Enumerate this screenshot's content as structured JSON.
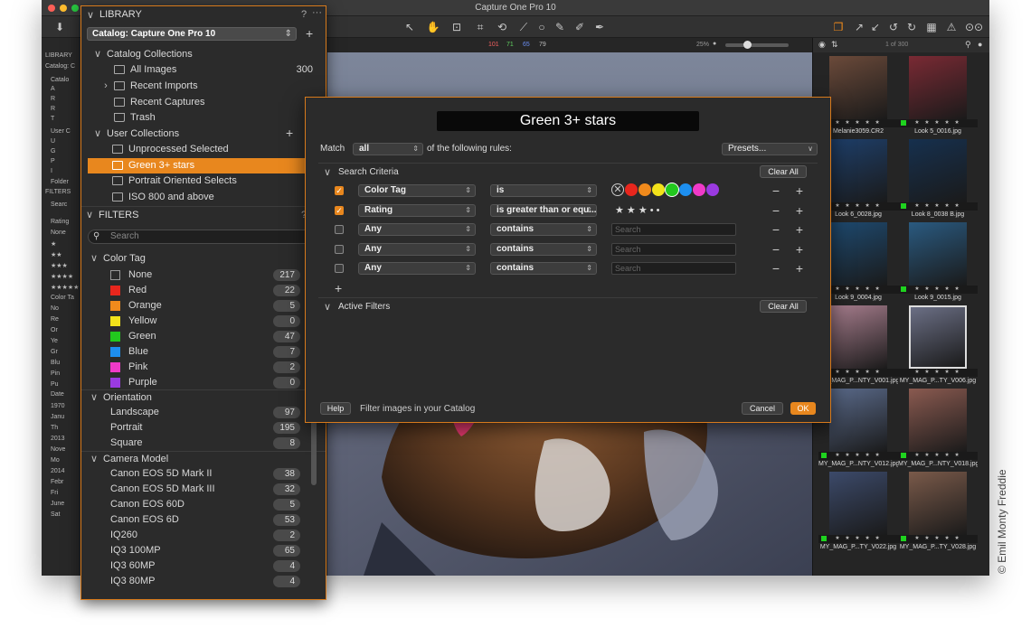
{
  "app": {
    "title": "Capture One Pro 10"
  },
  "viewer": {
    "counts": [
      "101",
      "71",
      "65",
      "79"
    ],
    "zoom": "25%"
  },
  "browser": {
    "counter": "1 of 300",
    "thumbs": [
      {
        "name": "Melanie3059.CR2",
        "stars": "★ ★ ★ ★ ★",
        "green": false
      },
      {
        "name": "Look 5_0016.jpg",
        "stars": "★ ★ ★ ★ ★",
        "green": true
      },
      {
        "name": "Look 6_0028.jpg",
        "stars": "★ ★ ★ ★ ★",
        "green": true
      },
      {
        "name": "Look 8_0038 B.jpg",
        "stars": "★ ★ ★ ★ ★",
        "green": true
      },
      {
        "name": "Look 9_0004.jpg",
        "stars": "★ ★ ★ ★ ★",
        "green": false
      },
      {
        "name": "Look 9_0015.jpg",
        "stars": "★ ★ ★ ★ ★",
        "green": true
      },
      {
        "name": "MY_MAG_P...NTY_V001.jpg",
        "stars": "★ ★ ★ ★ ★",
        "green": false
      },
      {
        "name": "MY_MAG_P...TY_V006.jpg",
        "stars": "★ ★ ★ ★ ★",
        "green": false
      },
      {
        "name": "MY_MAG_P...NTY_V012.jpg",
        "stars": "★ ★ ★ ★ ★",
        "green": true
      },
      {
        "name": "MY_MAG_P...NTY_V018.jpg",
        "stars": "★ ★ ★ ★ ★",
        "green": true
      },
      {
        "name": "MY_MAG_P...TY_V022.jpg",
        "stars": "★ ★ ★ ★ ★",
        "green": true
      },
      {
        "name": "MY_MAG_P...TY_V028.jpg",
        "stars": "★ ★ ★ ★ ★",
        "green": true
      }
    ]
  },
  "leftmini": {
    "rows": [
      "LIBRARY",
      "Catalog: C",
      "Catalo",
      "A",
      "R",
      "R",
      "T",
      "User C",
      "U",
      "G",
      "P",
      "I",
      "Folder",
      "FILTERS",
      "Searc",
      "Rating",
      "None",
      "★",
      "★★",
      "★★★",
      "★★★★",
      "★★★★★",
      "Color Ta",
      "No",
      "Re",
      "Or",
      "Ye",
      "Gr",
      "Blu",
      "Pin",
      "Pu",
      "Date",
      "1970",
      "Janu",
      "Th",
      "2013",
      "Nove",
      "Mo",
      "2014",
      "Febr",
      "Fri",
      "June",
      "Sat"
    ]
  },
  "library": {
    "title": "LIBRARY",
    "help": "?",
    "more": "···",
    "catalog_select": "Catalog: Capture One Pro 10",
    "catalog_collections": "Catalog Collections",
    "all_images": "All Images",
    "all_images_count": "300",
    "recent_imports": "Recent Imports",
    "recent_captures": "Recent Captures",
    "trash": "Trash",
    "user_collections": "User Collections",
    "user_items": [
      "Unprocessed Selected",
      "Green 3+ stars",
      "Portrait Oriented Selects",
      "ISO 800 and above"
    ],
    "filters_title": "FILTERS",
    "search_placeholder": "Search",
    "color_tag": "Color Tag",
    "colors": [
      {
        "label": "None",
        "count": "217",
        "color": "#2b2b2b"
      },
      {
        "label": "Red",
        "count": "22",
        "color": "#e8261d"
      },
      {
        "label": "Orange",
        "count": "5",
        "color": "#f08a1c"
      },
      {
        "label": "Yellow",
        "count": "0",
        "color": "#f2e21a"
      },
      {
        "label": "Green",
        "count": "47",
        "color": "#22c81e"
      },
      {
        "label": "Blue",
        "count": "7",
        "color": "#1d8ff0"
      },
      {
        "label": "Pink",
        "count": "2",
        "color": "#f03ac8"
      },
      {
        "label": "Purple",
        "count": "0",
        "color": "#9a3ae0"
      }
    ],
    "orientation": "Orientation",
    "orientations": [
      {
        "label": "Landscape",
        "count": "97"
      },
      {
        "label": "Portrait",
        "count": "195"
      },
      {
        "label": "Square",
        "count": "8"
      }
    ],
    "camera_model": "Camera Model",
    "cameras": [
      {
        "label": "Canon EOS 5D Mark II",
        "count": "38"
      },
      {
        "label": "Canon EOS 5D Mark III",
        "count": "32"
      },
      {
        "label": "Canon EOS 60D",
        "count": "5"
      },
      {
        "label": "Canon EOS 6D",
        "count": "53"
      },
      {
        "label": "IQ260",
        "count": "2"
      },
      {
        "label": "IQ3 100MP",
        "count": "65"
      },
      {
        "label": "IQ3 60MP",
        "count": "4"
      },
      {
        "label": "IQ3 80MP",
        "count": "4"
      }
    ]
  },
  "dialog": {
    "title": "Green 3+ stars",
    "match_label": "Match",
    "match_value": "all",
    "rules_label": "of the following rules:",
    "presets": "Presets...",
    "search_criteria": "Search Criteria",
    "clear_all": "Clear All",
    "rules": [
      {
        "field": "Color Tag",
        "op": "is",
        "checked": true
      },
      {
        "field": "Rating",
        "op": "is greater than or equ...",
        "checked": true
      },
      {
        "field": "Any",
        "op": "contains",
        "checked": false
      },
      {
        "field": "Any",
        "op": "contains",
        "checked": false
      },
      {
        "field": "Any",
        "op": "contains",
        "checked": false
      }
    ],
    "search_placeholder": "Search",
    "rating_stars": "★  ★  ★  •  •",
    "tag_colors": [
      "#e8261d",
      "#f08a1c",
      "#f2e21a",
      "#22c81e",
      "#1d8ff0",
      "#f03ac8",
      "#9a3ae0"
    ],
    "active_filters": "Active Filters",
    "help": "Help",
    "footer_text": "Filter images in your Catalog",
    "cancel": "Cancel",
    "ok": "OK"
  },
  "credit": "© Emil Monty Freddie"
}
